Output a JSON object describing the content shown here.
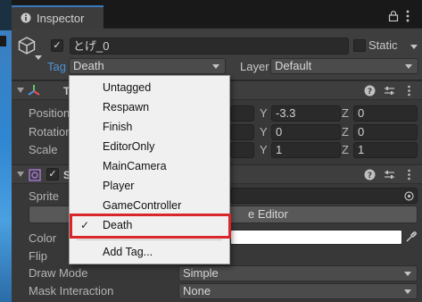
{
  "tab": {
    "label": "Inspector",
    "icon": "info-icon"
  },
  "header": {
    "object_name": "とげ_0",
    "active": true,
    "static_label": "Static",
    "tag_label": "Tag",
    "tag_value": "Death",
    "layer_label": "Layer",
    "layer_value": "Default"
  },
  "transform": {
    "title_visible": "T",
    "rows": [
      {
        "label": "Position",
        "y": "-3.3",
        "z": "0"
      },
      {
        "label": "Rotation",
        "y": "0",
        "z": "0"
      },
      {
        "label": "Scale",
        "y": "1",
        "z": "1"
      }
    ],
    "axis": {
      "y": "Y",
      "z": "Z"
    }
  },
  "sprite_renderer": {
    "title_visible": "S",
    "sprite_label": "Sprite",
    "open_editor_label": "e Editor",
    "color_label": "Color",
    "color_value": "#ffffff",
    "flip_label": "Flip",
    "draw_mode_label": "Draw Mode",
    "draw_mode_value": "Simple",
    "mask_label": "Mask Interaction",
    "mask_value": "None"
  },
  "tag_menu": {
    "items": [
      "Untagged",
      "Respawn",
      "Finish",
      "EditorOnly",
      "MainCamera",
      "Player",
      "GameController",
      "Death"
    ],
    "selected": "Death",
    "check_mark": "✓",
    "add_tag_label": "Add Tag...",
    "highlight_color": "#d9262b"
  },
  "colors": {
    "accent": "#3a79bb",
    "tag_label": "#4c93d6"
  }
}
